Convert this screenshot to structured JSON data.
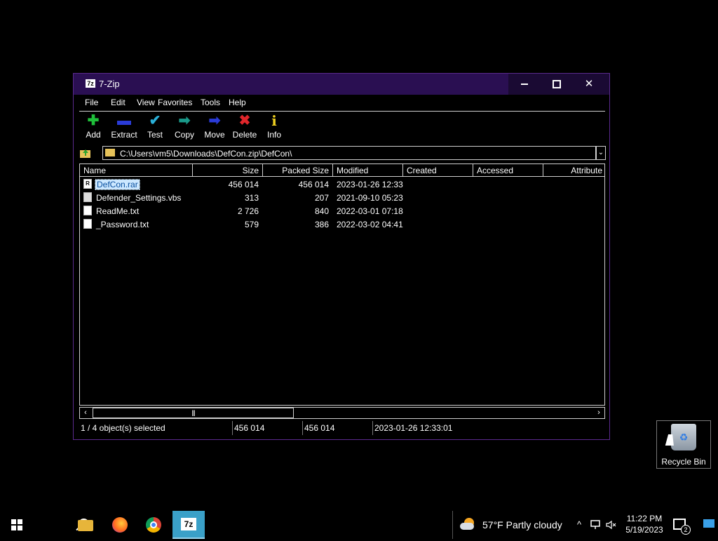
{
  "window": {
    "title": "7-Zip",
    "app_icon_text": "7z",
    "min_icon": "minimize-icon",
    "max_icon": "maximize-icon",
    "close_glyph": "✕"
  },
  "menu": [
    "File",
    "Edit",
    "View",
    "Favorites",
    "Tools",
    "Help"
  ],
  "toolbar": [
    {
      "label": "Add",
      "icon": "add-icon",
      "glyph": "✚",
      "color": "#1fbf3a"
    },
    {
      "label": "Extract",
      "icon": "extract-icon",
      "glyph": "▬",
      "color": "#2a3bd8"
    },
    {
      "label": "Test",
      "icon": "test-icon",
      "glyph": "✔",
      "color": "#2ab0d8"
    },
    {
      "label": "Copy",
      "icon": "copy-icon",
      "glyph": "➡",
      "color": "#1a9a8a"
    },
    {
      "label": "Move",
      "icon": "move-icon",
      "glyph": "➡",
      "color": "#2a3bd8"
    },
    {
      "label": "Delete",
      "icon": "delete-icon",
      "glyph": "✖",
      "color": "#e0262b"
    },
    {
      "label": "Info",
      "icon": "info-icon",
      "glyph": "i",
      "color": "#f0d020"
    }
  ],
  "address": {
    "path": "C:\\Users\\vm5\\Downloads\\DefCon.zip\\DefCon\\",
    "dropdown_glyph": "⌄"
  },
  "columns": [
    "Name",
    "Size",
    "Packed Size",
    "Modified",
    "Created",
    "Accessed",
    "Attribute"
  ],
  "files": [
    {
      "name": "DefCon.rar",
      "size": "456 014",
      "packed": "456 014",
      "modified": "2023-01-26 12:33",
      "type": "rar",
      "icon_text": "R"
    },
    {
      "name": "Defender_Settings.vbs",
      "size": "313",
      "packed": "207",
      "modified": "2021-09-10 05:23",
      "type": "vbs",
      "icon_text": ""
    },
    {
      "name": "ReadMe.txt",
      "size": "2 726",
      "packed": "840",
      "modified": "2022-03-01 07:18",
      "type": "txt",
      "icon_text": ""
    },
    {
      "name": "_Password.txt",
      "size": "579",
      "packed": "386",
      "modified": "2022-03-02 04:41",
      "type": "txt",
      "icon_text": ""
    }
  ],
  "scrollbar": {
    "left": "‹",
    "right": "›",
    "thumb": "|||"
  },
  "status": {
    "selection": "1 / 4 object(s) selected",
    "size": "456 014",
    "packed": "456 014",
    "modified": "2023-01-26 12:33:01"
  },
  "desktop": {
    "recycle_bin_label": "Recycle Bin"
  },
  "taskbar": {
    "weather_text": "57°F  Partly cloudy",
    "tray_chevron": "^",
    "time": "11:22 PM",
    "date": "5/19/2023",
    "notification_count": "2"
  }
}
